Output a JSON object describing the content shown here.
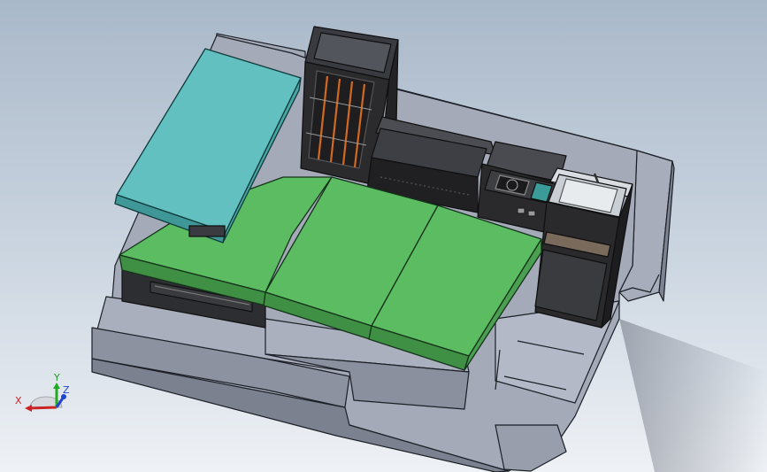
{
  "triad": {
    "x_label": "X",
    "y_label": "Y",
    "z_label": "Z"
  },
  "colors": {
    "background_top": "#a9b8c9",
    "background_bottom": "#eef1f5",
    "base_body": "#9aa0ad",
    "mattress_green": "#5cbc62",
    "fold_out_top": "#62c1c0",
    "cabinet_dark": "#2b2b2e",
    "accent_orange": "#d2691e",
    "sink_steel": "#cfd5da",
    "axis_x": "#cc2222",
    "axis_y": "#22aa22",
    "axis_z": "#2244cc"
  }
}
